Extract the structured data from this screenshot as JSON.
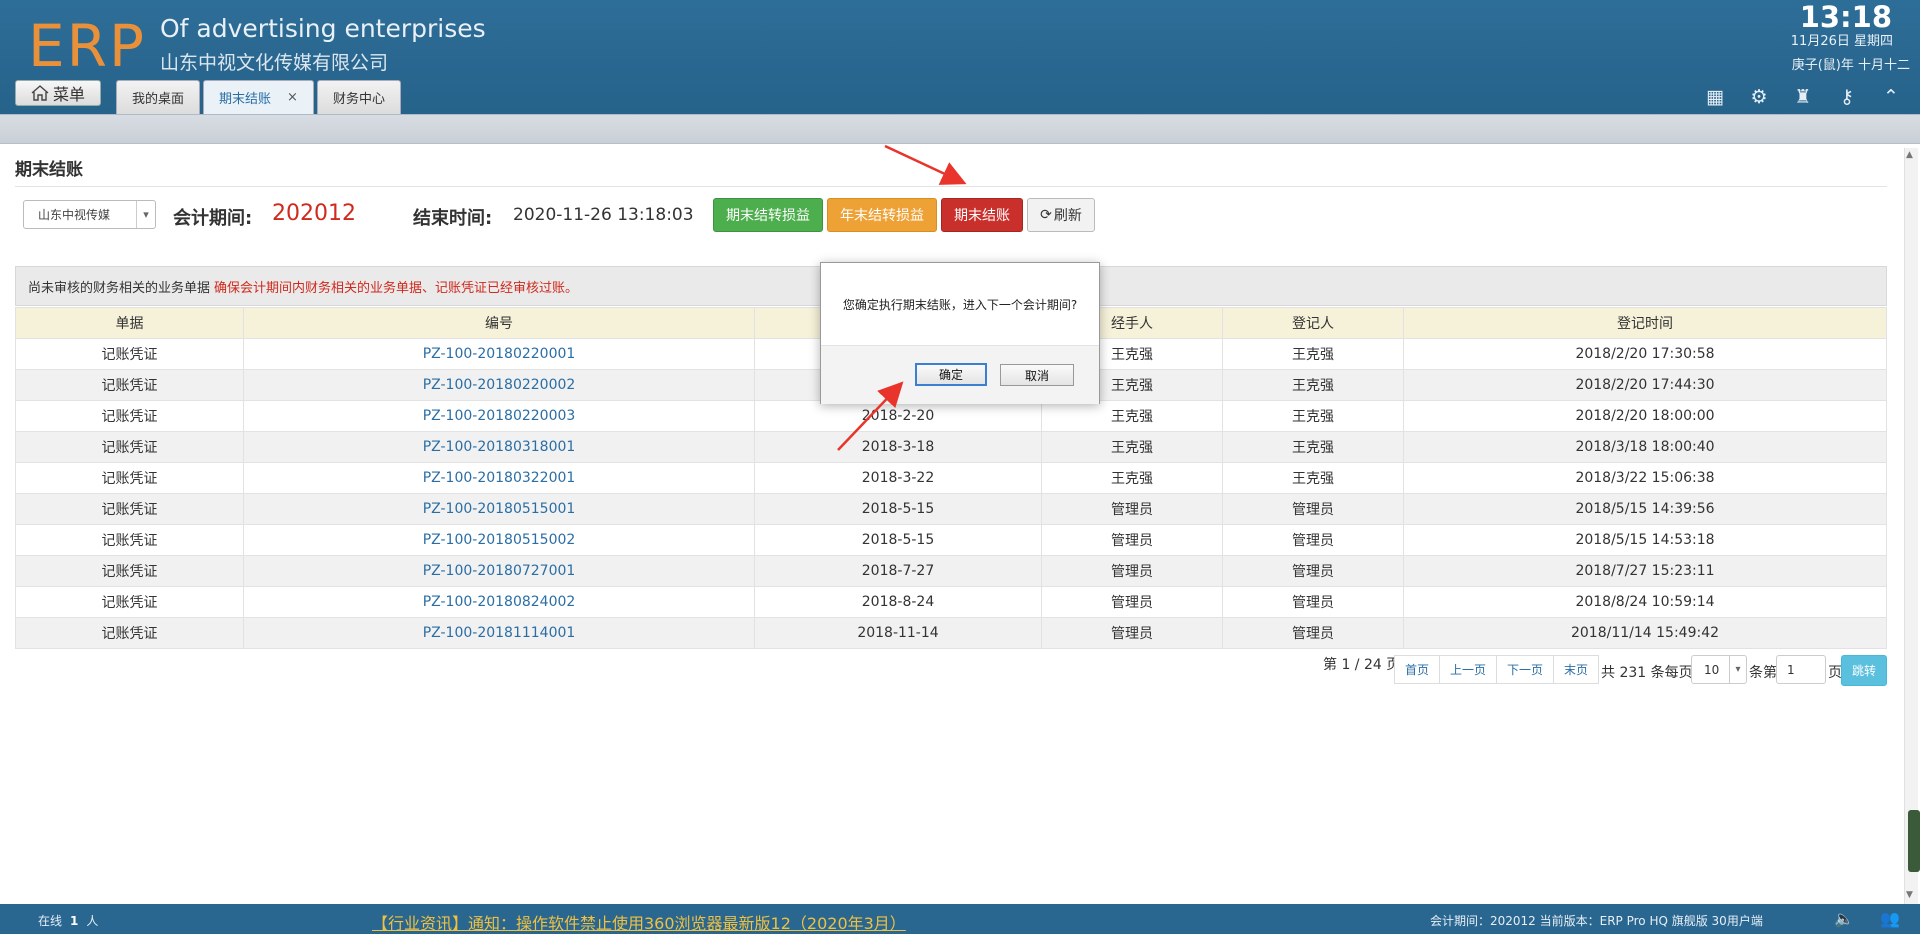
{
  "header": {
    "logo": "ERP",
    "company_en": "Of advertising enterprises",
    "company_cn": "山东中视文化传媒有限公司",
    "time": "13:18",
    "date_line1": "11月26日 星期四",
    "date_line2": "庚子(鼠)年 十月十二",
    "menu_label": "菜单",
    "tabs": [
      {
        "label": "我的桌面"
      },
      {
        "label": "期末结账",
        "close": "×"
      },
      {
        "label": "财务中心"
      }
    ]
  },
  "toolbar_icons": [
    "dashboard-icon",
    "gear-icon",
    "shirt-icon",
    "key-icon",
    "collapse-icon"
  ],
  "page": {
    "title": "期末结账",
    "company_select": "山东中视传媒",
    "period_label": "会计期间:",
    "period_value": "202012",
    "end_label": "结束时间:",
    "end_value": "2020-11-26 13:18:03",
    "buttons": {
      "transfer_pl": "期末结转损益",
      "year_transfer": "年末结转损益",
      "close_period": "期末结账",
      "refresh": "刷新"
    },
    "notice_text": "尚未审核的财务相关的业务单据",
    "notice_warning": "确保会计期间内财务相关的业务单据、记账凭证已经审核过账。"
  },
  "table": {
    "headers": [
      "单据",
      "编号",
      "",
      "经手人",
      "登记人",
      "登记时间"
    ],
    "rows": [
      [
        "记账凭证",
        "PZ-100-20180220001",
        "",
        "王克强",
        "王克强",
        "2018/2/20 17:30:58"
      ],
      [
        "记账凭证",
        "PZ-100-20180220002",
        "",
        "王克强",
        "王克强",
        "2018/2/20 17:44:30"
      ],
      [
        "记账凭证",
        "PZ-100-20180220003",
        "2018-2-20",
        "王克强",
        "王克强",
        "2018/2/20 18:00:00"
      ],
      [
        "记账凭证",
        "PZ-100-20180318001",
        "2018-3-18",
        "王克强",
        "王克强",
        "2018/3/18 18:00:40"
      ],
      [
        "记账凭证",
        "PZ-100-20180322001",
        "2018-3-22",
        "王克强",
        "王克强",
        "2018/3/22 15:06:38"
      ],
      [
        "记账凭证",
        "PZ-100-20180515001",
        "2018-5-15",
        "管理员",
        "管理员",
        "2018/5/15 14:39:56"
      ],
      [
        "记账凭证",
        "PZ-100-20180515002",
        "2018-5-15",
        "管理员",
        "管理员",
        "2018/5/15 14:53:18"
      ],
      [
        "记账凭证",
        "PZ-100-20180727001",
        "2018-7-27",
        "管理员",
        "管理员",
        "2018/7/27 15:23:11"
      ],
      [
        "记账凭证",
        "PZ-100-20180824002",
        "2018-8-24",
        "管理员",
        "管理员",
        "2018/8/24 10:59:14"
      ],
      [
        "记账凭证",
        "PZ-100-20181114001",
        "2018-11-14",
        "管理员",
        "管理员",
        "2018/11/14 15:49:42"
      ]
    ]
  },
  "pager": {
    "info": "第 1 / 24 页",
    "first": "首页",
    "prev": "上一页",
    "next": "下一页",
    "last": "末页",
    "total": "共 231 条每页",
    "page_size": "10",
    "per_page_suffix": "条第",
    "page_input": "1",
    "page_unit": "页",
    "jump": "跳转"
  },
  "modal": {
    "message": "您确定执行期末结账，进入下一个会计期间?",
    "ok": "确定",
    "cancel": "取消"
  },
  "footer": {
    "online_label": "在线",
    "online_count": "1",
    "online_unit": "人",
    "news": "【行业资讯】通知：操作软件禁止使用360浏览器最新版12（2020年3月）",
    "version": "会计期间：202012 当前版本：ERP Pro HQ 旗舰版 30用户端"
  },
  "colors": {
    "header_bg": "#2a6790",
    "logo": "#e8913a",
    "period_red": "#d0291d",
    "btn_green": "#4cae4c",
    "btn_orange": "#eea236",
    "btn_red": "#c9302c",
    "link": "#2a6ea5",
    "annotation_arrow": "#e8342a"
  }
}
